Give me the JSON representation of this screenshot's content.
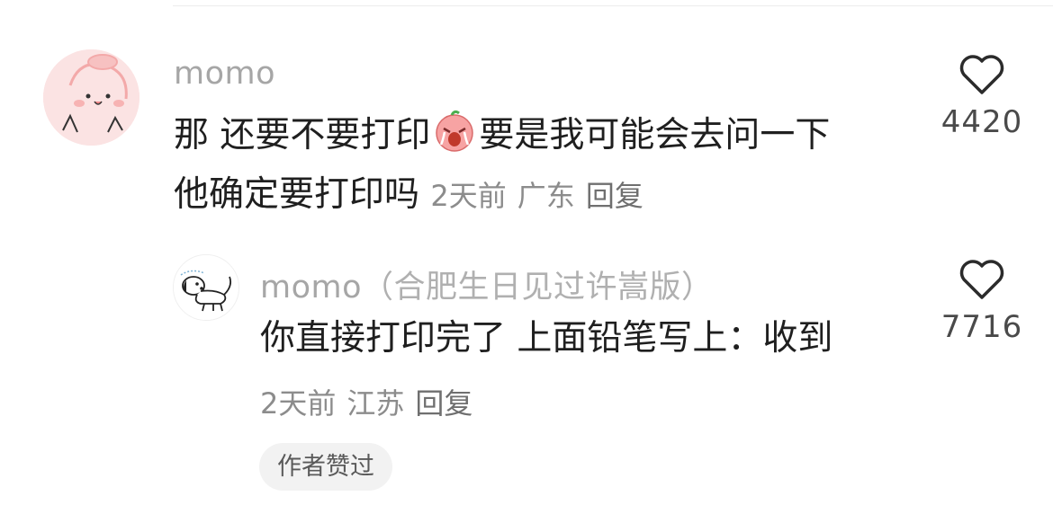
{
  "main_comment": {
    "username": "momo",
    "text_part1": "那 还要不要打印",
    "emoji_name": "crying-face-emoji",
    "text_part2": "要是我可能会去问一下",
    "text_line2": "他确定要打印吗",
    "time": "2天前",
    "location": "广东",
    "reply_label": "回复",
    "like_count": "4420"
  },
  "reply_comment": {
    "username": "momo",
    "username_suffix": "（合肥生日见过许嵩版）",
    "text": "你直接打印完了 上面铅笔写上：收到",
    "time": "2天前",
    "location": "江苏",
    "reply_label": "回复",
    "like_count": "7716",
    "author_liked_badge": "作者赞过"
  },
  "colors": {
    "username": "#a6a6a6",
    "content": "#1f1f1f",
    "meta": "#8c8c8c",
    "badge_bg": "#f2f2f2",
    "avatar_main_bg": "#fbe1e1"
  }
}
